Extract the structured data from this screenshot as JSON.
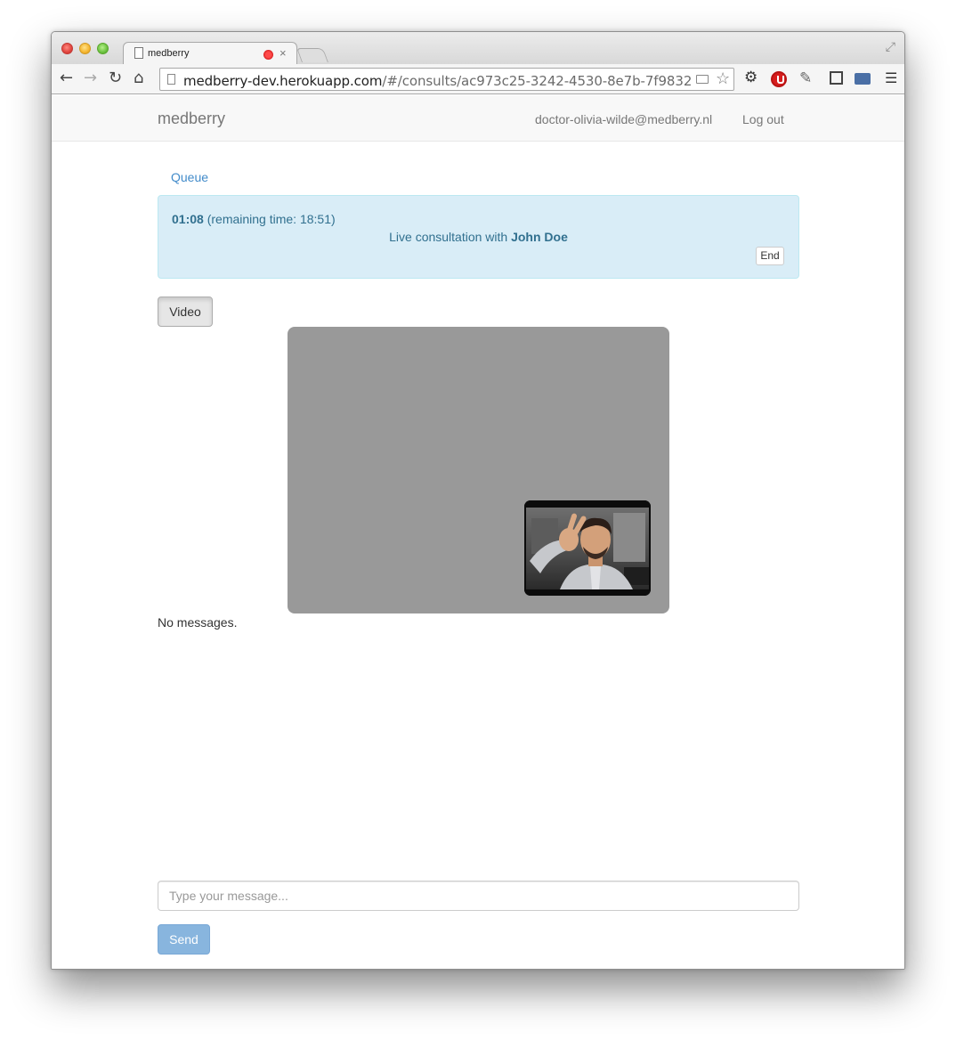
{
  "browser": {
    "tab_title": "medberry",
    "url_host": "medberry-dev.herokuapp.com",
    "url_path": "/#/consults/ac973c25-3242-4530-8e7b-7f98322…",
    "tab_close": "×"
  },
  "navbar": {
    "brand": "medberry",
    "user_email": "doctor-olivia-wilde@medberry.nl",
    "logout_label": "Log out"
  },
  "breadcrumb": {
    "queue_label": "Queue"
  },
  "consult": {
    "elapsed": "01:08",
    "remaining_text": "(remaining time: 18:51)",
    "live_prefix": "Live consultation with",
    "patient_name": "John Doe",
    "end_label": "End"
  },
  "video": {
    "toggle_label": "Video"
  },
  "chat": {
    "empty_text": "No messages.",
    "input_placeholder": "Type your message...",
    "send_label": "Send"
  },
  "colors": {
    "alert_bg": "#d9edf7",
    "alert_text": "#31708f",
    "link": "#428bca",
    "send_button": "#88b5de",
    "video_stage": "#999999"
  }
}
